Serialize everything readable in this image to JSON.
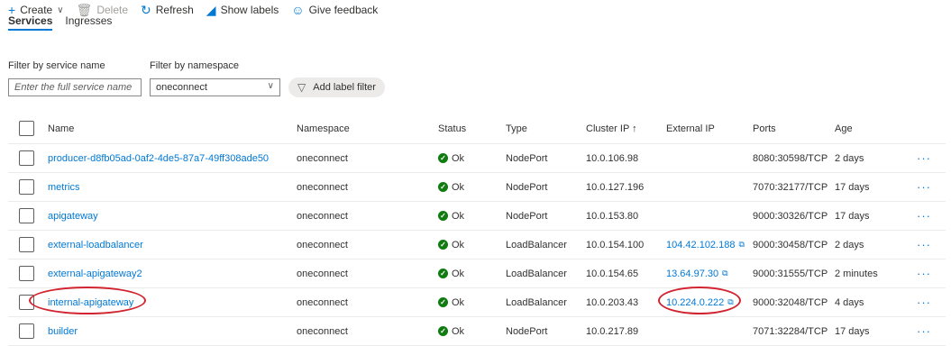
{
  "toolbar": {
    "create": "Create",
    "delete": "Delete",
    "refresh": "Refresh",
    "show_labels": "Show labels",
    "give_feedback": "Give feedback"
  },
  "tabs": [
    "Services",
    "Ingresses"
  ],
  "filters": {
    "service_name_label": "Filter by service name",
    "service_name_placeholder": "Enter the full service name",
    "namespace_label": "Filter by namespace",
    "namespace_value": "oneconnect",
    "add_label_filter": "Add label filter"
  },
  "table": {
    "headers": {
      "name": "Name",
      "namespace": "Namespace",
      "status": "Status",
      "type": "Type",
      "cluster_ip": "Cluster IP ↑",
      "external_ip": "External IP",
      "ports": "Ports",
      "age": "Age"
    },
    "rows": [
      {
        "name": "producer-d8fb05ad-0af2-4de5-87a7-49ff308ade50",
        "namespace": "oneconnect",
        "status": "Ok",
        "type": "NodePort",
        "cluster_ip": "10.0.106.98",
        "external_ip": "",
        "ports": "8080:30598/TCP",
        "age": "2 days",
        "more": "···"
      },
      {
        "name": "metrics",
        "namespace": "oneconnect",
        "status": "Ok",
        "type": "NodePort",
        "cluster_ip": "10.0.127.196",
        "external_ip": "",
        "ports": "7070:32177/TCP",
        "age": "17 days",
        "more": "···"
      },
      {
        "name": "apigateway",
        "namespace": "oneconnect",
        "status": "Ok",
        "type": "NodePort",
        "cluster_ip": "10.0.153.80",
        "external_ip": "",
        "ports": "9000:30326/TCP",
        "age": "17 days",
        "more": "···"
      },
      {
        "name": "external-loadbalancer",
        "namespace": "oneconnect",
        "status": "Ok",
        "type": "LoadBalancer",
        "cluster_ip": "10.0.154.100",
        "external_ip": "104.42.102.188",
        "ports": "9000:30458/TCP",
        "age": "2 days",
        "more": "···"
      },
      {
        "name": "external-apigateway2",
        "namespace": "oneconnect",
        "status": "Ok",
        "type": "LoadBalancer",
        "cluster_ip": "10.0.154.65",
        "external_ip": "13.64.97.30",
        "ports": "9000:31555/TCP",
        "age": "2 minutes",
        "more": "···"
      },
      {
        "name": "internal-apigateway",
        "namespace": "oneconnect",
        "status": "Ok",
        "type": "LoadBalancer",
        "cluster_ip": "10.0.203.43",
        "external_ip": "10.224.0.222",
        "ports": "9000:32048/TCP",
        "age": "4 days",
        "more": "···"
      },
      {
        "name": "builder",
        "namespace": "oneconnect",
        "status": "Ok",
        "type": "NodePort",
        "cluster_ip": "10.0.217.89",
        "external_ip": "",
        "ports": "7071:32284/TCP",
        "age": "17 days",
        "more": "···"
      }
    ]
  },
  "colors": {
    "accent": "#0078d4",
    "ok": "#107c10",
    "annotation_ring": "#d1242f"
  }
}
